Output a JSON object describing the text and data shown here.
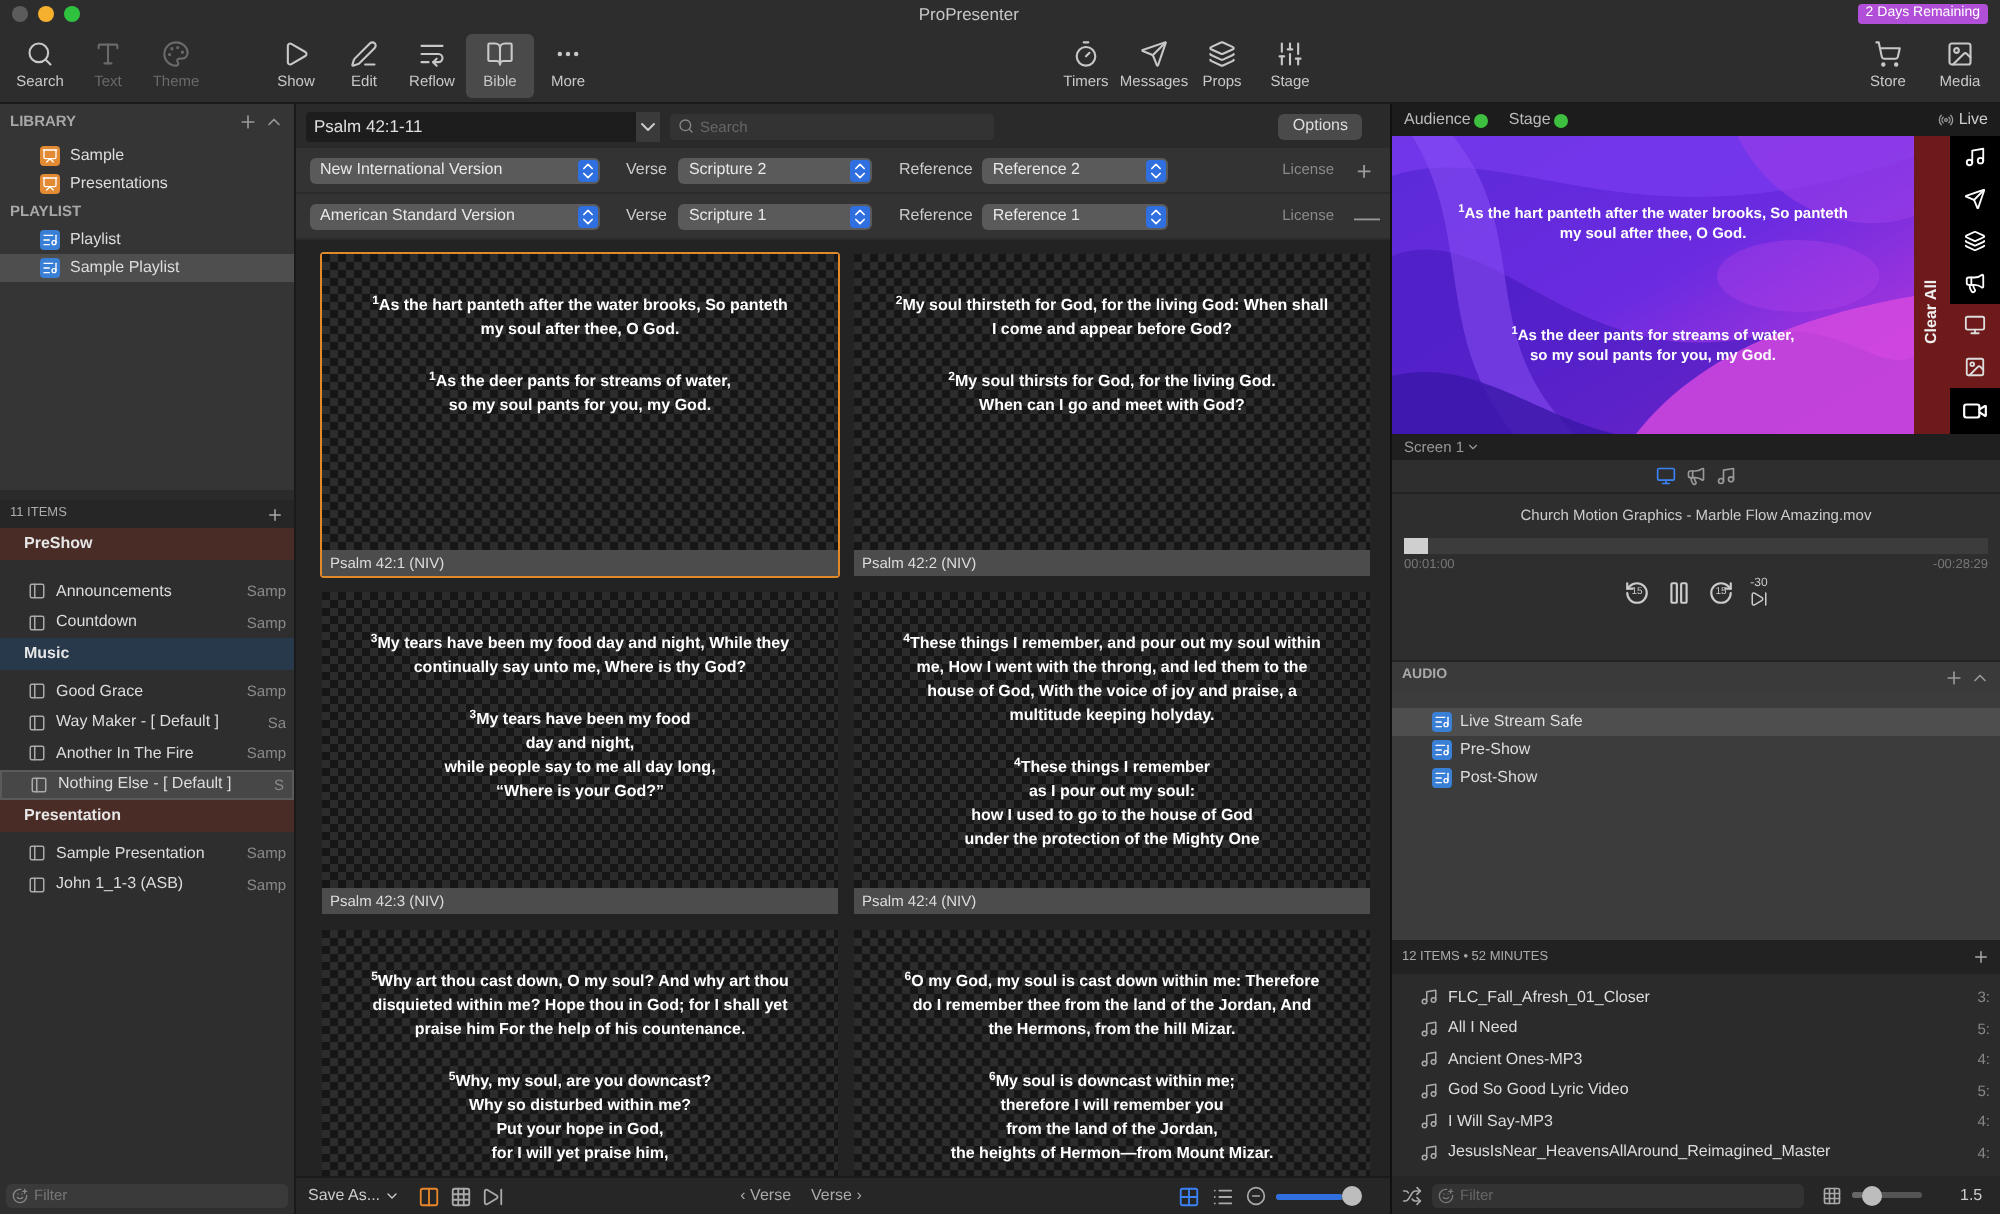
{
  "window": {
    "title": "ProPresenter",
    "badge": "2 Days Remaining"
  },
  "toolbar": {
    "groups": [
      [
        {
          "kind": "search",
          "label": "Search",
          "disabled": false,
          "selected": false
        },
        {
          "kind": "text",
          "label": "Text",
          "disabled": true,
          "selected": false
        },
        {
          "kind": "theme",
          "label": "Theme",
          "disabled": true,
          "selected": false
        }
      ],
      [
        {
          "kind": "show",
          "label": "Show",
          "disabled": false,
          "selected": false
        },
        {
          "kind": "edit",
          "label": "Edit",
          "disabled": false,
          "selected": false
        },
        {
          "kind": "reflow",
          "label": "Reflow",
          "disabled": false,
          "selected": false
        },
        {
          "kind": "bible",
          "label": "Bible",
          "disabled": false,
          "selected": true
        },
        {
          "kind": "more",
          "label": "More",
          "disabled": false,
          "selected": false
        }
      ],
      [
        {
          "kind": "timers",
          "label": "Timers",
          "disabled": false,
          "selected": false
        },
        {
          "kind": "messages",
          "label": "Messages",
          "disabled": false,
          "selected": false
        },
        {
          "kind": "props",
          "label": "Props",
          "disabled": false,
          "selected": false
        },
        {
          "kind": "stage",
          "label": "Stage",
          "disabled": false,
          "selected": false
        }
      ],
      [
        {
          "kind": "store",
          "label": "Store",
          "disabled": false,
          "selected": false
        },
        {
          "kind": "media",
          "label": "Media",
          "disabled": false,
          "selected": false
        }
      ]
    ]
  },
  "library": {
    "sections": [
      {
        "title": "LIBRARY",
        "kind": "library",
        "items": [
          {
            "label": "Sample",
            "selected": false
          },
          {
            "label": "Presentations",
            "selected": false
          }
        ]
      },
      {
        "title": "PLAYLIST",
        "kind": "playlist",
        "items": [
          {
            "label": "Playlist",
            "selected": false
          },
          {
            "label": "Sample Playlist",
            "selected": true
          }
        ]
      }
    ]
  },
  "playlist": {
    "count": "11 ITEMS",
    "groups": [
      {
        "title": "PreShow",
        "color": "#4a2c27",
        "items": [
          {
            "name": "Announcements",
            "library": "Samp",
            "selected": false
          },
          {
            "name": "Countdown",
            "library": "Samp",
            "selected": false
          }
        ]
      },
      {
        "title": "Music",
        "color": "#27394b",
        "items": [
          {
            "name": "Good Grace",
            "library": "Samp",
            "selected": false
          },
          {
            "name": "Way Maker - [ Default ]",
            "library": "Sa",
            "selected": false
          },
          {
            "name": "Another In The Fire",
            "library": "Samp",
            "selected": false
          },
          {
            "name": "Nothing Else - [ Default ]",
            "library": "S",
            "selected": true
          }
        ]
      },
      {
        "title": "Presentation",
        "color": "#4a2c27",
        "items": [
          {
            "name": "Sample Presentation",
            "library": "Samp",
            "selected": false
          },
          {
            "name": "John 1_1-3 (ASB)",
            "library": "Samp",
            "selected": false
          }
        ]
      }
    ],
    "filter_placeholder": "Filter"
  },
  "bible": {
    "passage": "Psalm 42:1-11",
    "search_placeholder": "Search",
    "options": "Options",
    "versions": [
      {
        "version": "New International Version",
        "verse_label": "Verse",
        "verse": "Scripture 2",
        "reference_label": "Reference",
        "reference": "Reference 2",
        "license": "License",
        "action": "+"
      },
      {
        "version": "American Standard Version",
        "verse_label": "Verse",
        "verse": "Scripture 1",
        "reference_label": "Reference",
        "reference": "Reference 1",
        "license": "License",
        "action": "—"
      }
    ],
    "slides": [
      {
        "label": "Psalm 42:1 (NIV)",
        "selected": true,
        "blocks": [
          [
            "$^{1}$As the hart panteth after the water brooks, So panteth",
            "my soul after thee, O God."
          ],
          [
            "$^{1}$As the deer pants for streams of water,",
            "so my soul pants for you, my God."
          ]
        ]
      },
      {
        "label": "Psalm 42:2 (NIV)",
        "selected": false,
        "blocks": [
          [
            "$^{2}$My soul thirsteth for God, for the living God: When shall",
            "I come and appear before God?"
          ],
          [
            "$^{2}$My soul thirsts for God, for the living God.",
            "When can I go and meet with God?"
          ]
        ]
      },
      {
        "label": "Psalm 42:3 (NIV)",
        "selected": false,
        "blocks": [
          [
            "$^{3}$My tears have been my food day and night, While they",
            "continually say unto me, Where is thy God?"
          ],
          [
            "$^{3}$My tears have been my food",
            "day and night,",
            "while people say to me all day long,",
            "“Where is your God?”"
          ]
        ]
      },
      {
        "label": "Psalm 42:4 (NIV)",
        "selected": false,
        "blocks": [
          [
            "$^{4}$These things I remember, and pour out my soul within",
            "me, How I went with the throng, and led them to the",
            "house of God, With the voice of joy and praise, a",
            "multitude keeping holyday."
          ],
          [
            "$^{4}$These things I remember",
            "as I pour out my soul:",
            "how I used to go to the house of God",
            "under the protection of the Mighty One"
          ]
        ]
      },
      {
        "selected": false,
        "blocks": [
          [
            "$^{5}$Why art thou cast down, O my soul? And why art thou",
            "disquieted within me? Hope thou in God; for I shall yet",
            "praise him For the help of his countenance."
          ],
          [
            "$^{5}$Why, my soul, are you downcast?",
            "Why so disturbed within me?",
            "Put your hope in God,",
            "for I will yet praise him,"
          ]
        ]
      },
      {
        "selected": false,
        "blocks": [
          [
            "$^{6}$O my God, my soul is cast down within me: Therefore",
            "do I remember thee from the land of the Jordan, And",
            "the Hermons, from the hill Mizar."
          ],
          [
            "$^{6}$My soul is downcast within me;",
            "therefore I will remember you",
            "from the land of the Jordan,",
            "the heights of Hermon—from Mount Mizar."
          ]
        ]
      }
    ],
    "footer": {
      "save": "Save As...",
      "prev": "‹ Verse",
      "next": "Verse ›",
      "zoom": {
        "level": 0.93
      }
    }
  },
  "output": {
    "screens": [
      {
        "label": "Audience",
        "color": "#3fbf3f"
      },
      {
        "label": "Stage",
        "color": "#3fbf3f"
      }
    ],
    "live": "Live",
    "preview_blocks": [
      [
        "$^{1}$As the hart panteth after the water brooks, So panteth",
        "my soul after thee, O God."
      ],
      [
        "$^{1}$As the deer pants for streams of water,",
        "so my soul pants for you, my God."
      ]
    ],
    "clear": "Clear All",
    "screen": "Screen 1"
  },
  "media": {
    "title": "Church Motion Graphics - Marble Flow Amazing.mov",
    "level": 0.04,
    "elapsed": "00:01:00",
    "remaining": "-00:28:29",
    "back": "15",
    "forward": "15",
    "skip": "-30"
  },
  "audio": {
    "title": "AUDIO",
    "items": [
      {
        "label": "Live Stream Safe",
        "selected": true
      },
      {
        "label": "Pre-Show",
        "selected": false
      },
      {
        "label": "Post-Show",
        "selected": false
      }
    ],
    "summary": "12 ITEMS • 52 MINUTES",
    "tracks": [
      {
        "name": "FLC_Fall_Afresh_01_Closer",
        "time": "3:"
      },
      {
        "name": "All I Need",
        "time": "5:"
      },
      {
        "name": "Ancient Ones-MP3",
        "time": "4:"
      },
      {
        "name": "God So Good Lyric Video",
        "time": "5:"
      },
      {
        "name": "I Will Say-MP3",
        "time": "4:"
      },
      {
        "name": "JesusIsNear_HeavensAllAround_Reimagined_Master",
        "time": "4:"
      }
    ],
    "filter_placeholder": "Filter",
    "volume": {
      "level": 0.15,
      "value": "1.5"
    }
  }
}
